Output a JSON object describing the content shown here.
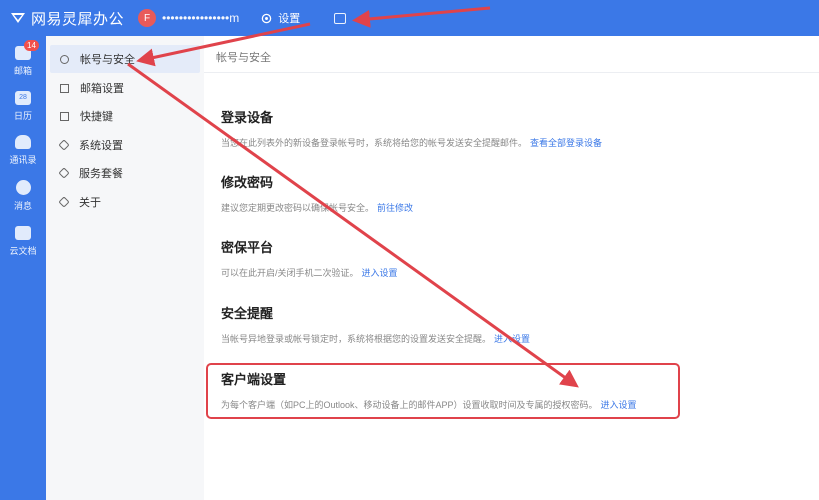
{
  "app": {
    "title": "网易灵犀办公"
  },
  "user": {
    "avatar_letter": "F",
    "email": "••••••••••••••••m"
  },
  "topbar": {
    "settings_label": "设置"
  },
  "rail": [
    {
      "label": "邮箱",
      "icon": "mail-icon",
      "badge": "14"
    },
    {
      "label": "日历",
      "icon": "calendar-icon",
      "day": "28"
    },
    {
      "label": "通讯录",
      "icon": "contacts-icon"
    },
    {
      "label": "消息",
      "icon": "chat-icon"
    },
    {
      "label": "云文档",
      "icon": "folder-icon"
    }
  ],
  "sidebar": {
    "items": [
      {
        "label": "帐号与安全",
        "icon": "user-icon",
        "active": true
      },
      {
        "label": "邮箱设置",
        "icon": "mail-outline-icon"
      },
      {
        "label": "快捷键",
        "icon": "keyboard-icon"
      },
      {
        "label": "系统设置",
        "icon": "gear-icon"
      },
      {
        "label": "服务套餐",
        "icon": "package-icon"
      },
      {
        "label": "关于",
        "icon": "info-icon"
      }
    ]
  },
  "main": {
    "breadcrumb": "帐号与安全",
    "sections": [
      {
        "title": "登录设备",
        "desc": "当您在此列表外的新设备登录帐号时，系统将给您的帐号发送安全提醒邮件。",
        "link": "查看全部登录设备"
      },
      {
        "title": "修改密码",
        "desc": "建议您定期更改密码以确保帐号安全。",
        "link": "前往修改"
      },
      {
        "title": "密保平台",
        "desc": "可以在此开启/关闭手机二次验证。",
        "link": "进入设置"
      },
      {
        "title": "安全提醒",
        "desc": "当帐号异地登录或帐号锁定时，系统将根据您的设置发送安全提醒。",
        "link": "进入设置"
      },
      {
        "title": "客户端设置",
        "desc": "为每个客户端（如PC上的Outlook、移动设备上的邮件APP）设置收取时间及专属的授权密码。",
        "link": "进入设置"
      }
    ]
  },
  "colors": {
    "brand": "#3b78e7",
    "annotation": "#e0434b",
    "link": "#3b78e7"
  }
}
